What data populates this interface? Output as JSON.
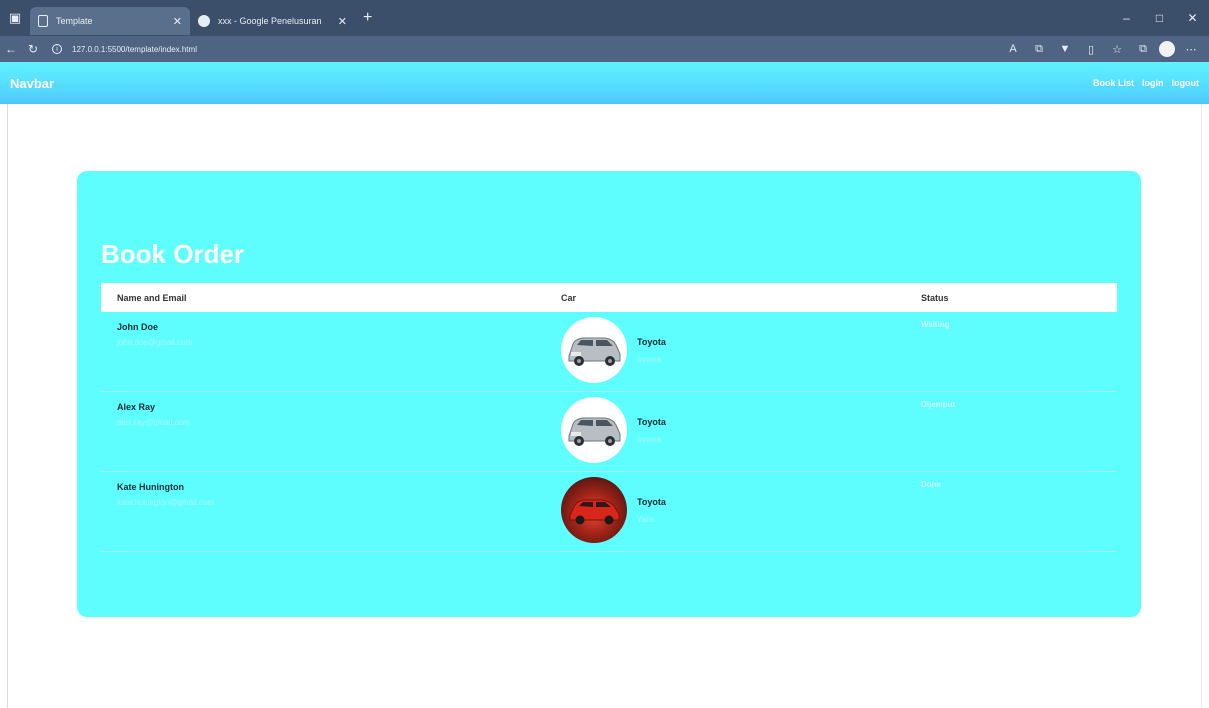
{
  "browser": {
    "tabs": [
      {
        "title": "Template",
        "active": true
      },
      {
        "title": "xxx - Google Penelusuran",
        "active": false
      }
    ],
    "new_tab_label": "+",
    "url": "127.0.0.1:5500/template/index.html",
    "window_controls": [
      "–",
      "□",
      "✕"
    ]
  },
  "navbar": {
    "brand": "Navbar",
    "links": [
      "Book List",
      "login",
      "logout"
    ]
  },
  "book_order": {
    "title": "Book Order",
    "columns": [
      "Name and Email",
      "Car",
      "Status"
    ],
    "rows": [
      {
        "name": "John Doe",
        "email": "john.doe@gmail.com",
        "car": "Toyota",
        "model": "Innova",
        "status": "Waiting",
        "car_color": "silver"
      },
      {
        "name": "Alex Ray",
        "email": "alex.ray@gmail.com",
        "car": "Toyota",
        "model": "Innova",
        "status": "Dijemput",
        "car_color": "silver"
      },
      {
        "name": "Kate Hunington",
        "email": "kate.hunington@gmail.com",
        "car": "Toyota",
        "model": "Yaris",
        "status": "Done",
        "car_color": "red"
      }
    ]
  },
  "colors": {
    "card": "#5efeff",
    "navbar": "#54d7ff",
    "tabbar": "#3c4f6a"
  }
}
